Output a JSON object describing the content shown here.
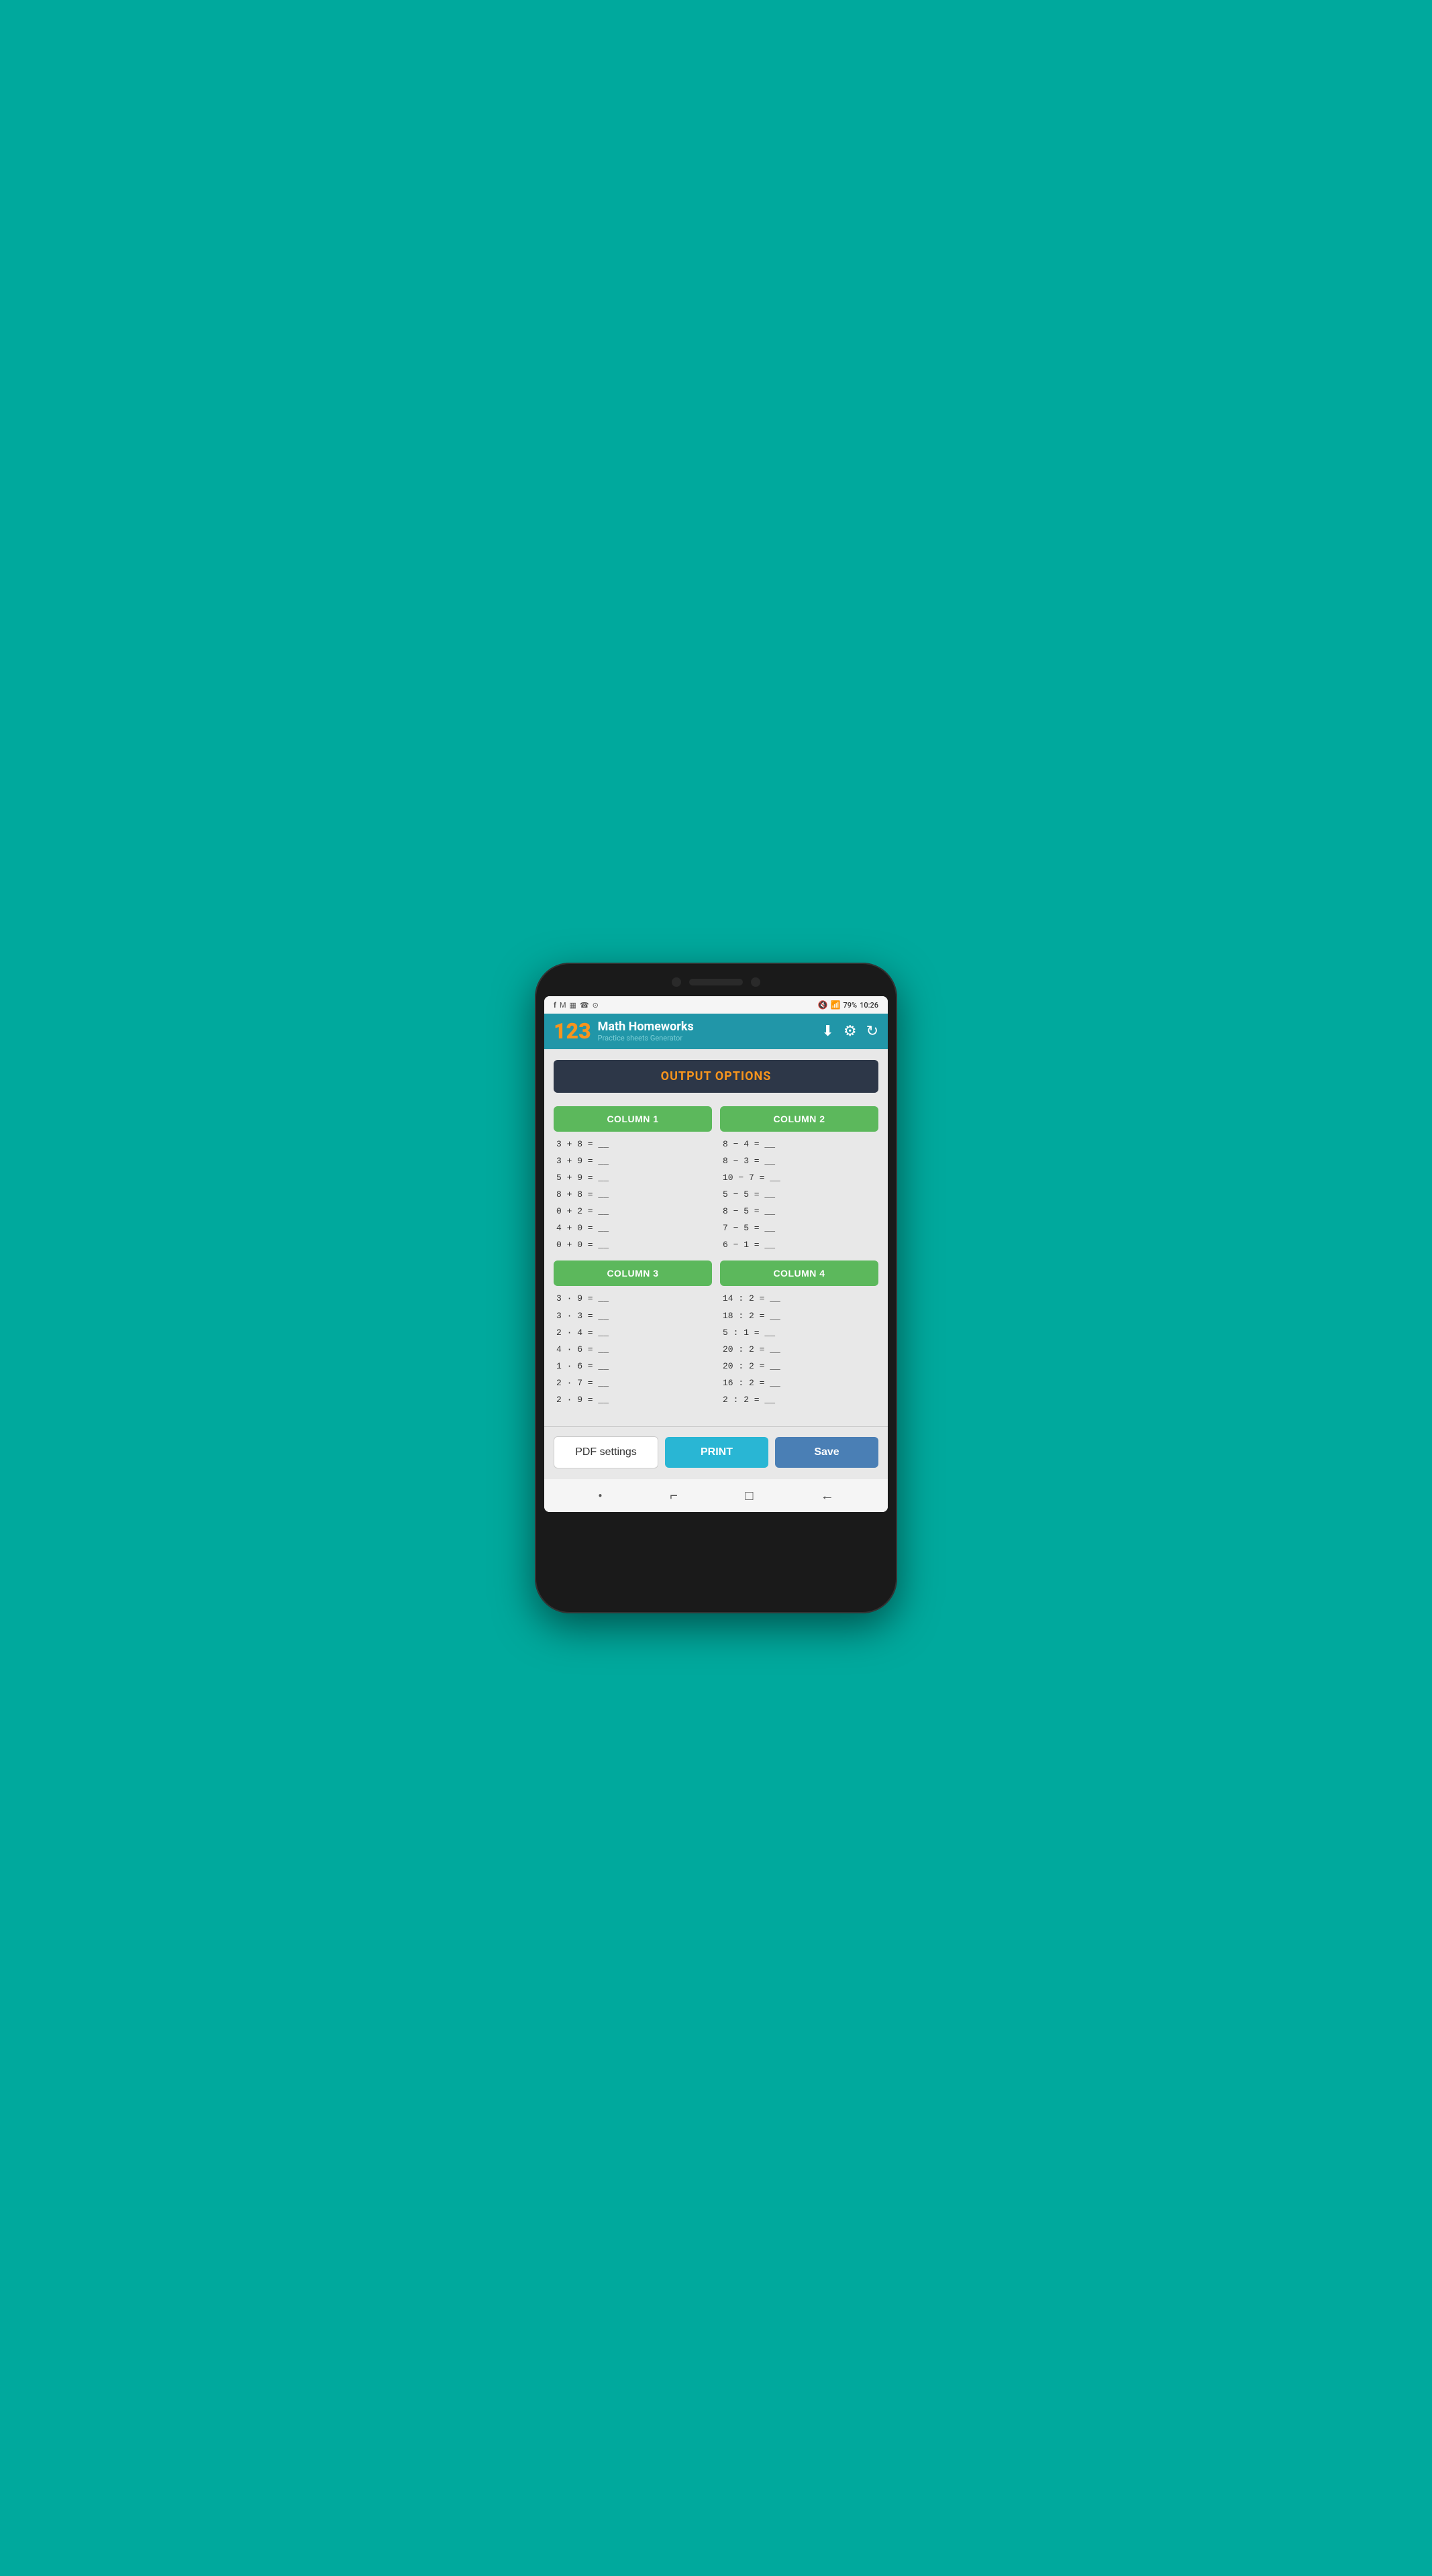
{
  "statusBar": {
    "time": "10:26",
    "battery": "79%",
    "icons": [
      "f",
      "m",
      "img",
      "phone",
      "inst"
    ]
  },
  "header": {
    "logo123": "123",
    "title": "Math Homeworks",
    "subtitle": "Practice sheets Generator"
  },
  "sectionHeader": "OUTPUT OPTIONS",
  "column1": {
    "label": "COLUMN 1",
    "equations": [
      "3 + 8  =  __",
      "3 + 9  =  __",
      "5 + 9  =  __",
      "8 + 8  =  __",
      "0 + 2  =  __",
      "4 + 0  =  __",
      "0 + 0  =  __"
    ]
  },
  "column2": {
    "label": "COLUMN 2",
    "equations": [
      "8 − 4  =  __",
      "8 − 3  =  __",
      "10 − 7 =  __",
      "5 − 5  =  __",
      "8 − 5  =  __",
      "7 − 5  =  __",
      "6 − 1  =  __"
    ]
  },
  "column3": {
    "label": "COLUMN 3",
    "equations": [
      "3 · 9  =  __",
      "3 · 3  =  __",
      "2 · 4  =  __",
      "4 · 6  =  __",
      "1 · 6  =  __",
      "2 · 7  =  __",
      "2 · 9  =  __"
    ]
  },
  "column4": {
    "label": "COLUMN 4",
    "equations": [
      "14 : 2  =  __",
      "18 : 2  =  __",
      " 5 : 1  =  __",
      "20 : 2  =  __",
      "20 : 2  =  __",
      "16 : 2  =  __",
      " 2 : 2  =  __"
    ]
  },
  "buttons": {
    "pdfSettings": "PDF settings",
    "print": "PRINT",
    "save": "Save"
  }
}
